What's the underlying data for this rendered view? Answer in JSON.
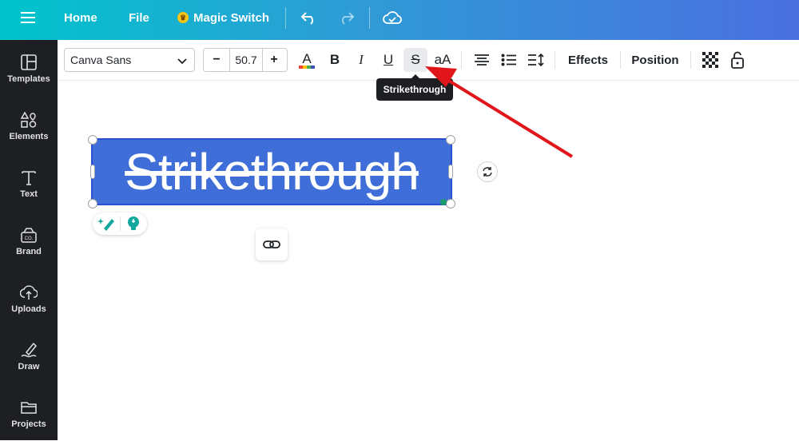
{
  "topbar": {
    "home_label": "Home",
    "file_label": "File",
    "magic_switch_label": "Magic Switch"
  },
  "sidebar": {
    "items": [
      {
        "label": "Templates",
        "icon": "templates-icon"
      },
      {
        "label": "Elements",
        "icon": "elements-icon"
      },
      {
        "label": "Text",
        "icon": "text-icon"
      },
      {
        "label": "Brand",
        "icon": "brand-icon"
      },
      {
        "label": "Uploads",
        "icon": "uploads-icon"
      },
      {
        "label": "Draw",
        "icon": "draw-icon"
      },
      {
        "label": "Projects",
        "icon": "projects-icon"
      }
    ]
  },
  "toolbar": {
    "font_family": "Canva Sans",
    "font_size": "50.7",
    "decrease_label": "−",
    "increase_label": "+",
    "bold_label": "B",
    "italic_label": "I",
    "underline_label": "U",
    "strikethrough_label": "S",
    "case_label": "aA",
    "effects_label": "Effects",
    "position_label": "Position"
  },
  "tooltip": {
    "text": "Strikethrough"
  },
  "canvas": {
    "text_content": "Strikethrough"
  },
  "colors": {
    "accent_blue": "#3f6ed8",
    "annotation_arrow": "#e0161b",
    "sidebar_bg": "#1e1f23"
  }
}
